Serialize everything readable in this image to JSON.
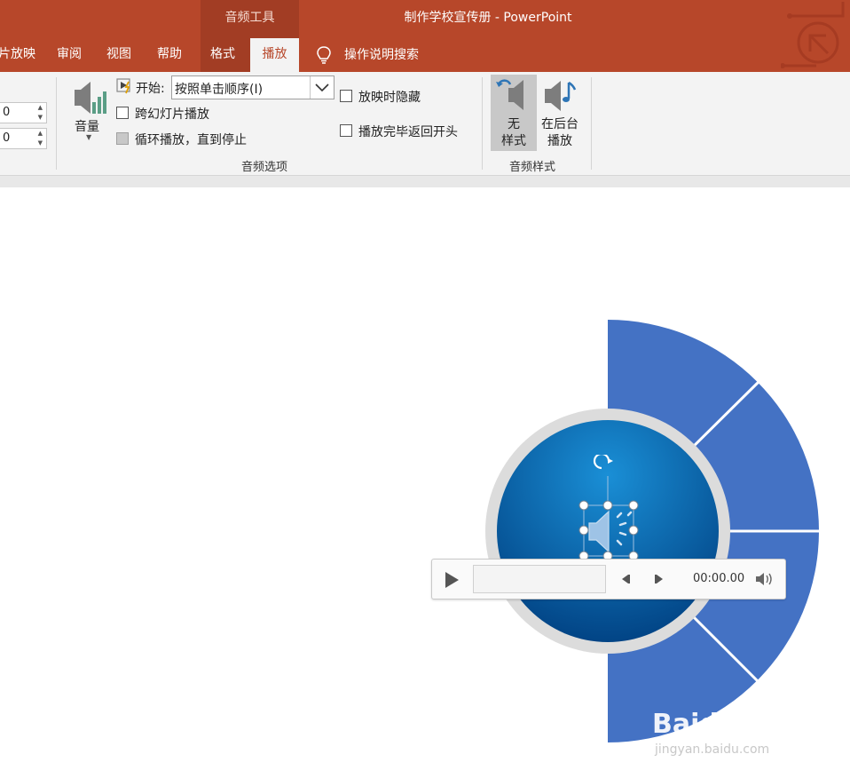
{
  "titlebar": {
    "context_label": "音频工具",
    "document_title": "制作学校宣传册  -  PowerPoint",
    "accent_color": "#b7472a"
  },
  "tabs": [
    {
      "label": "片放映"
    },
    {
      "label": "审阅"
    },
    {
      "label": "视图"
    },
    {
      "label": "帮助"
    },
    {
      "label": "格式"
    },
    {
      "label": "播放",
      "active": true
    }
  ],
  "tell_me": {
    "label": "操作说明搜索",
    "icon": "lightbulb-icon"
  },
  "ribbon": {
    "editing": {
      "fade_in_value": "0",
      "fade_out_value": "0"
    },
    "volume": {
      "label": "音量",
      "icon": "speaker-volume-icon"
    },
    "audio_options": {
      "start_label": "开始:",
      "start_value": "按照单击顺序(I)",
      "cross_slides": {
        "label": "跨幻灯片播放",
        "checked": false
      },
      "loop": {
        "label": "循环播放，直到停止",
        "checked": false,
        "disabled": true
      },
      "hide_during_show": {
        "label": "放映时隐藏",
        "checked": false
      },
      "rewind": {
        "label": "播放完毕返回开头",
        "checked": false
      },
      "group_label": "音频选项"
    },
    "audio_styles": {
      "no_style_line1": "无",
      "no_style_line2": "样式",
      "background_line1": "在后台",
      "background_line2": "播放",
      "group_label": "音频样式"
    }
  },
  "slide": {
    "shape_color": "#4472c4",
    "circle_color": "#0a70b8",
    "player": {
      "time": "00:00.00"
    }
  },
  "watermark": {
    "logo": "Baidu经验",
    "url": "jingyan.baidu.com"
  }
}
